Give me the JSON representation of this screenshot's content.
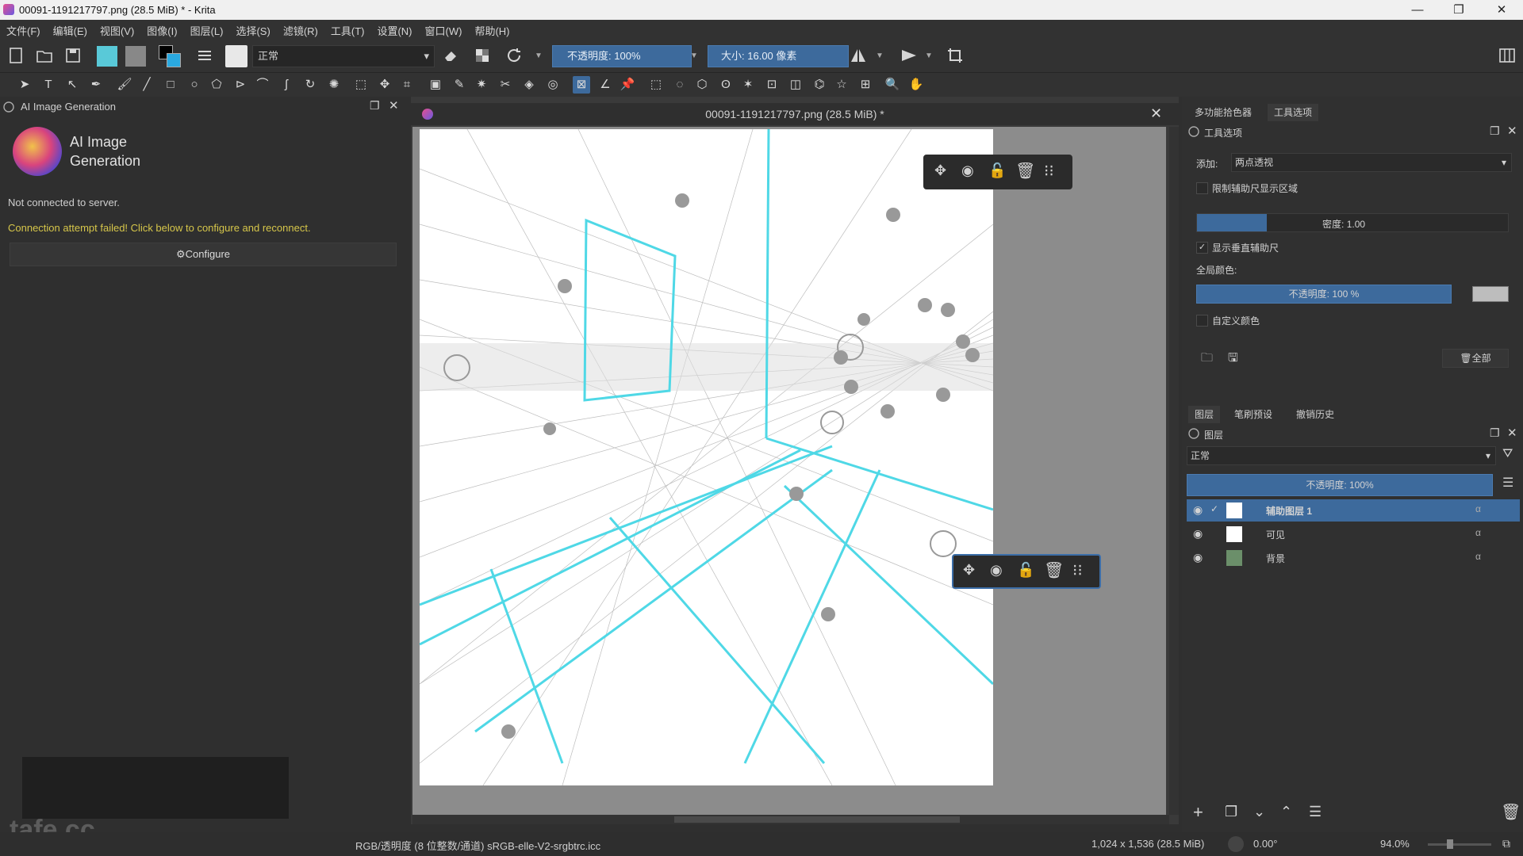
{
  "window": {
    "title": "00091-1191217797.png (28.5 MiB) * - Krita",
    "minimize": "—",
    "maximize": "❐",
    "close": "✕"
  },
  "menu": [
    "文件(F)",
    "编辑(E)",
    "视图(V)",
    "图像(I)",
    "图层(L)",
    "选择(S)",
    "滤镜(R)",
    "工具(T)",
    "设置(N)",
    "窗口(W)",
    "帮助(H)"
  ],
  "toolbar": {
    "blend_mode": "正常",
    "opacity_label": "不透明度:",
    "opacity_value": "100%",
    "size_label": "大小:",
    "size_value": "16.00 像素"
  },
  "left_docker": {
    "header": "AI Image Generation",
    "plugin_name_line1": "AI Image",
    "plugin_name_line2": "Generation",
    "status": "Not connected to server.",
    "error": "Connection attempt failed! Click below to configure and reconnect.",
    "configure_label": "Configure",
    "watermark": "tafe.cc"
  },
  "document": {
    "tab_title": "00091-1191217797.png (28.5 MiB) *"
  },
  "right_docker": {
    "tabs_top": [
      "多功能拾色器",
      "工具选项"
    ],
    "tool_options_title": "工具选项",
    "add_label": "添加:",
    "add_value": "两点透视",
    "limit_area_label": "限制辅助尺显示区域",
    "density_label": "密度:",
    "density_value": "1.00",
    "show_assistants_label": "显示垂直辅助尺",
    "global_color_label": "全局颜色:",
    "global_opacity_label": "不透明度:",
    "global_opacity_value": "100 %",
    "custom_color_label": "自定义颜色",
    "all_button": "全部",
    "tabs_bottom": [
      "图层",
      "笔刷预设",
      "撤销历史"
    ],
    "layers_title": "图层",
    "layer_blend": "正常",
    "layer_opacity": "不透明度: 100%",
    "layers": [
      {
        "name": "辅助图层 1",
        "selected": true
      },
      {
        "name": "可见",
        "selected": false
      },
      {
        "name": "背景",
        "selected": false
      }
    ]
  },
  "status_bar": {
    "color_space": "RGB/透明度 (8 位整数/通道)  sRGB-elle-V2-srgbtrc.icc",
    "dimensions": "1,024 x 1,536 (28.5 MiB)",
    "rotation": "0.00°",
    "zoom": "94.0%"
  },
  "colors": {
    "accent": "#3d6a9c",
    "warning_text": "#d6c64a",
    "perspective_lines": "#4fd8e6"
  }
}
